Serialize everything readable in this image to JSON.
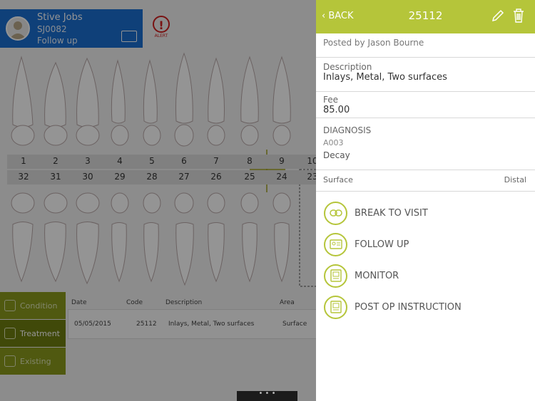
{
  "patient": {
    "name": "Stive Jobs",
    "id": "SJ0082",
    "status": "Follow up"
  },
  "alert": {
    "label": "ALERT",
    "symbol": "!"
  },
  "chart": {
    "upper_numbers": [
      "1",
      "2",
      "3",
      "4",
      "5",
      "6",
      "7",
      "8",
      "9",
      "10"
    ],
    "lower_numbers": [
      "32",
      "31",
      "30",
      "29",
      "28",
      "27",
      "26",
      "25",
      "24",
      "23"
    ]
  },
  "sidebar": {
    "tabs": [
      {
        "label": "Condition"
      },
      {
        "label": "Treatment"
      },
      {
        "label": "Existing"
      }
    ]
  },
  "table": {
    "headers": {
      "date": "Date",
      "code": "Code",
      "description": "Description",
      "area": "Area"
    },
    "row": {
      "date": "05/05/2015",
      "code": "25112",
      "description": "Inlays, Metal, Two surfaces",
      "area": "Surface"
    }
  },
  "bottom_bar": {
    "label": "• • •"
  },
  "panel": {
    "back_label": "BACK",
    "title": "25112",
    "posted_by": "Posted by Jason Bourne",
    "description_label": "Description",
    "description_value": "Inlays, Metal, Two surfaces",
    "fee_label": "Fee",
    "fee_value": "85.00",
    "diagnosis_label": "DIAGNOSIS",
    "diagnosis_code": "A003",
    "diagnosis_value": "Decay",
    "surface_label": "Surface",
    "surface_value": "Distal",
    "actions": [
      {
        "label": "BREAK TO VISIT",
        "icon": "link-icon"
      },
      {
        "label": "FOLLOW UP",
        "icon": "id-card-icon"
      },
      {
        "label": "MONITOR",
        "icon": "monitor-icon"
      },
      {
        "label": "POST OP INSTRUCTION",
        "icon": "document-icon"
      }
    ]
  },
  "colors": {
    "accent": "#b5c53a",
    "patient_bar": "#1b6fd0",
    "alert": "#d02020",
    "sidebar": "#8a9a1c"
  }
}
